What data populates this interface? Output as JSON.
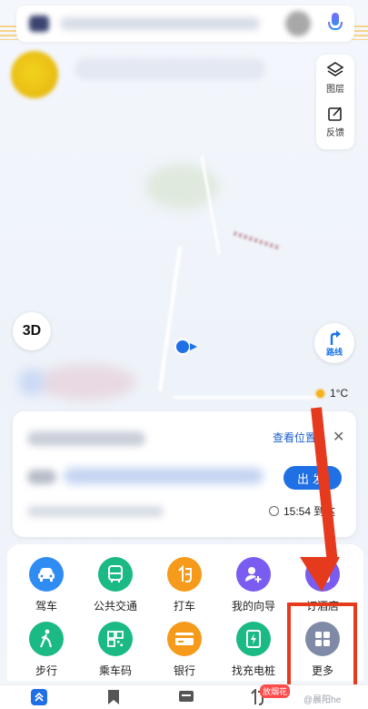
{
  "map": {
    "layers_label": "图层",
    "feedback_label": "反馈",
    "view_3d_label": "3D",
    "route_label": "路线",
    "temperature": "1°C"
  },
  "card": {
    "view_location_label": "查看位置",
    "close_symbol": "✕",
    "go_button_label": "出发",
    "eta_time": "15:54",
    "eta_suffix": "到达"
  },
  "services": {
    "row1": [
      {
        "label": "驾车",
        "icon": "car-icon",
        "color": "#2f8cf2"
      },
      {
        "label": "公共交通",
        "icon": "bus-icon",
        "color": "#1bb984"
      },
      {
        "label": "打车",
        "icon": "taxi-icon",
        "color": "#f59a1a"
      },
      {
        "label": "我的向导",
        "icon": "guide-icon",
        "color": "#7a5cf0"
      },
      {
        "label": "订酒店",
        "icon": "hotel-icon",
        "color": "#7a5cf0"
      }
    ],
    "row2": [
      {
        "label": "步行",
        "icon": "walk-icon",
        "color": "#1bb984"
      },
      {
        "label": "乘车码",
        "icon": "qrcode-icon",
        "color": "#1bb984"
      },
      {
        "label": "银行",
        "icon": "bank-icon",
        "color": "#f59a1a"
      },
      {
        "label": "找充电桩",
        "icon": "charging-icon",
        "color": "#1bb984"
      },
      {
        "label": "更多",
        "icon": "more-grid-icon",
        "color": "#7f8aa6"
      }
    ]
  },
  "tabbar": {
    "badge": "放烟花"
  },
  "colors": {
    "accent": "#1f6fe5",
    "annotation": "#e63a1f"
  }
}
